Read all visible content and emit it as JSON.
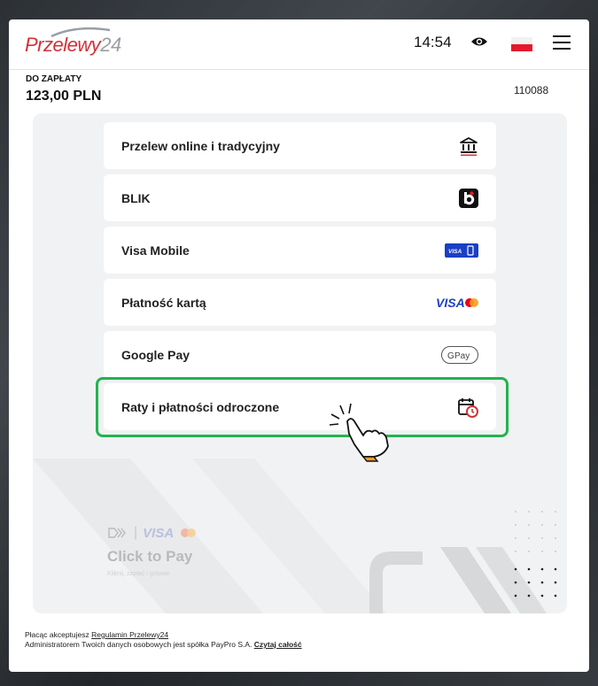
{
  "brand": {
    "logo_text": "Przelewy",
    "logo_num": "24",
    "accent": "#d13239"
  },
  "header": {
    "time": "14:54",
    "icons": [
      "eye-icon",
      "flag-pl-icon",
      "hamburger-menu-icon"
    ]
  },
  "payment": {
    "due_label": "DO ZAPŁATY",
    "due_amount": "123,00 PLN",
    "order_id": "110088"
  },
  "methods": [
    {
      "label": "Przelew online i tradycyjny",
      "icon": "bank-icon"
    },
    {
      "label": "BLIK",
      "icon": "blik-icon"
    },
    {
      "label": "Visa Mobile",
      "icon": "visa-mobile-icon"
    },
    {
      "label": "Płatność kartą",
      "icon": "visa-mastercard-icon"
    },
    {
      "label": "Google Pay",
      "icon": "google-pay-icon"
    },
    {
      "label": "Raty i płatności odroczone",
      "icon": "calendar-clock-icon"
    }
  ],
  "highlight_color": "#22b44f",
  "click_to_pay": {
    "visa": "VISA",
    "title": "Click to Pay",
    "subtitle": "Kliknij, zapłać i gotowe"
  },
  "footer": {
    "line1_prefix": "Płacąc akceptujesz ",
    "line1_link": "Regulamin Przelewy24",
    "line2_prefix": "Administratorem Twoich danych osobowych jest spółka PayPro S.A. ",
    "line2_link": "Czytaj całość"
  }
}
